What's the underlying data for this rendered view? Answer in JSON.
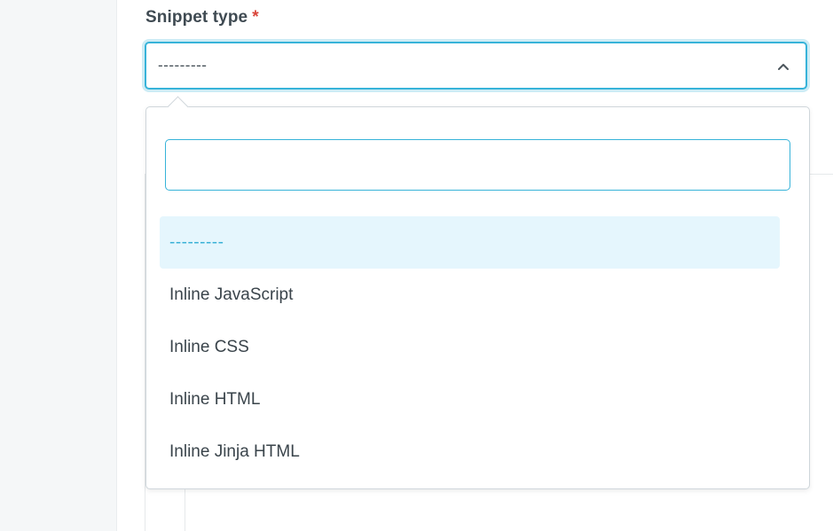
{
  "field": {
    "label": "Snippet type",
    "required_marker": "*",
    "selected_value": "---------"
  },
  "dropdown": {
    "search": {
      "value": "",
      "placeholder": ""
    },
    "options": [
      {
        "label": "---------",
        "selected": true
      },
      {
        "label": "Inline JavaScript",
        "selected": false
      },
      {
        "label": "Inline CSS",
        "selected": false
      },
      {
        "label": "Inline HTML",
        "selected": false
      },
      {
        "label": "Inline Jinja HTML",
        "selected": false
      }
    ]
  },
  "icons": {
    "select_toggle": "chevron-up-icon"
  },
  "colors": {
    "accent": "#37b3d9",
    "required": "#d9453a",
    "selected_bg": "#e5f6fd",
    "selected_text": "#39b1d6",
    "label_text": "#3f4a52"
  }
}
